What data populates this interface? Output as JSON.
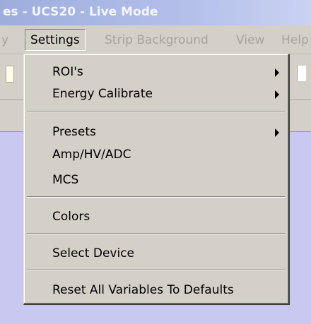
{
  "window": {
    "title": "es - UCS20 - Live Mode"
  },
  "menubar": {
    "items": [
      {
        "label": "y"
      },
      {
        "label": "Settings"
      },
      {
        "label": "Strip Background"
      },
      {
        "label": "View"
      },
      {
        "label": "Help"
      }
    ]
  },
  "settings_menu": {
    "items": [
      {
        "label": "ROI's",
        "submenu": true
      },
      {
        "label": "Energy Calibrate",
        "submenu": true
      },
      {
        "label": "Presets",
        "submenu": true
      },
      {
        "label": "Amp/HV/ADC",
        "submenu": false
      },
      {
        "label": "MCS",
        "submenu": false
      },
      {
        "label": "Colors",
        "submenu": false
      },
      {
        "label": "Select Device",
        "submenu": false
      },
      {
        "label": "Reset All Variables To Defaults",
        "submenu": false
      }
    ]
  },
  "icons": {
    "submenu_arrow": "chevron-right-icon"
  },
  "colors": {
    "menu_background": "#d4d0c8",
    "workspace_background": "#c8c8f0",
    "titlebar_inactive": "#b4c0ea"
  }
}
